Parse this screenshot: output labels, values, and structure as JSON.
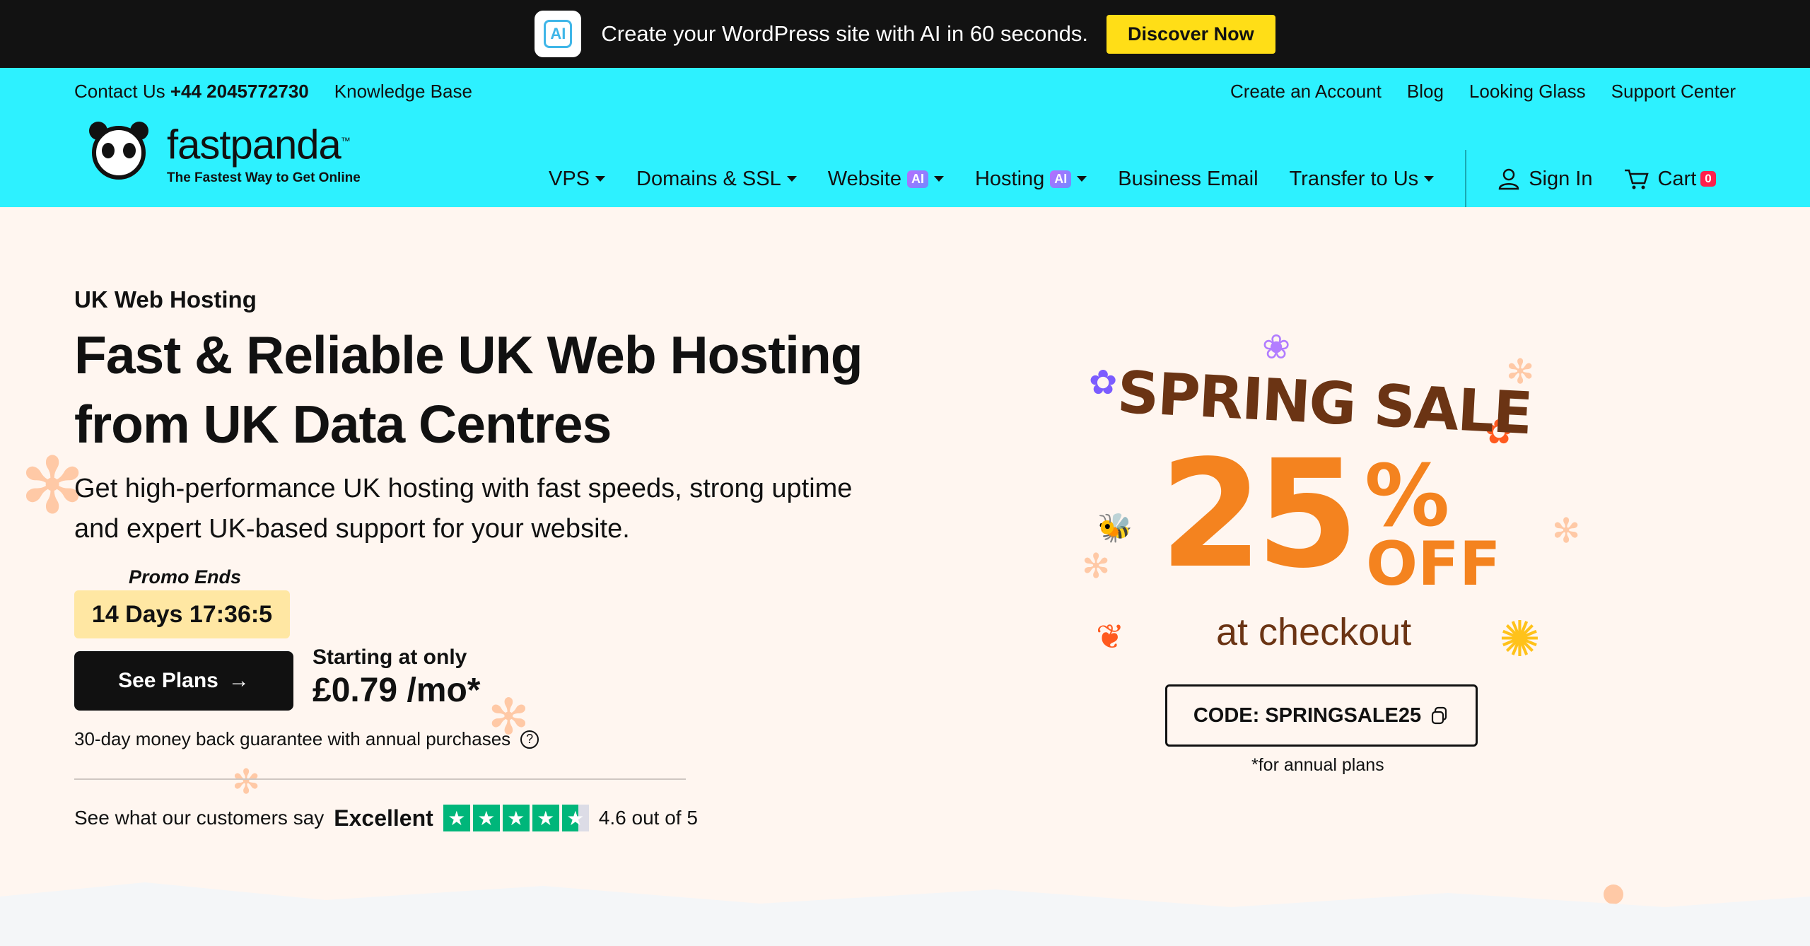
{
  "announcement": {
    "text": "Create your WordPress site with AI in 60 seconds.",
    "cta": "Discover Now",
    "icon": "ai-sparkle-icon"
  },
  "topbar": {
    "contact_label": "Contact Us",
    "phone": "+44 2045772730",
    "knowledge_base": "Knowledge Base",
    "links": [
      "Create an Account",
      "Blog",
      "Looking Glass",
      "Support Center"
    ]
  },
  "logo": {
    "name": "fastpanda",
    "tm": "™",
    "tagline": "The Fastest Way to Get Online"
  },
  "nav": {
    "vps": "VPS",
    "domains": "Domains & SSL",
    "website": "Website",
    "hosting": "Hosting",
    "ai_tag": "AI",
    "business_email": "Business Email",
    "transfer": "Transfer to Us",
    "sign_in": "Sign In",
    "cart": "Cart",
    "cart_count": "0"
  },
  "hero": {
    "eyebrow": "UK Web Hosting",
    "title_line1": "Fast & Reliable UK Web Hosting",
    "title_line2": "from UK Data Centres",
    "subtitle_line1": "Get high-performance UK hosting with fast speeds, strong uptime",
    "subtitle_line2": "and expert UK-based support for your website.",
    "promo_label": "Promo Ends",
    "timer": "14 Days 17:36:5",
    "cta": "See Plans",
    "starting_label": "Starting at only",
    "price": "£0.79 /mo*",
    "guarantee": "30-day money back guarantee with annual purchases",
    "reviews_prefix": "See what our customers say",
    "reviews_rating_word": "Excellent",
    "reviews_score": "4.6 out of 5",
    "stars": 4.6
  },
  "sale": {
    "title": "SPRING SALE",
    "percent": "25",
    "percent_sign": "%",
    "off": "OFF",
    "checkout": "at checkout",
    "code": "CODE: SPRINGSALE25",
    "note": "*for annual plans"
  },
  "colors": {
    "announce_bg": "#121212",
    "header_bg": "#2df1ff",
    "hero_bg": "#fff6f0",
    "cta_yellow": "#ffde17",
    "sale_orange": "#f4831f",
    "sale_brown": "#6b3414",
    "trustpilot_green": "#00b67a"
  }
}
